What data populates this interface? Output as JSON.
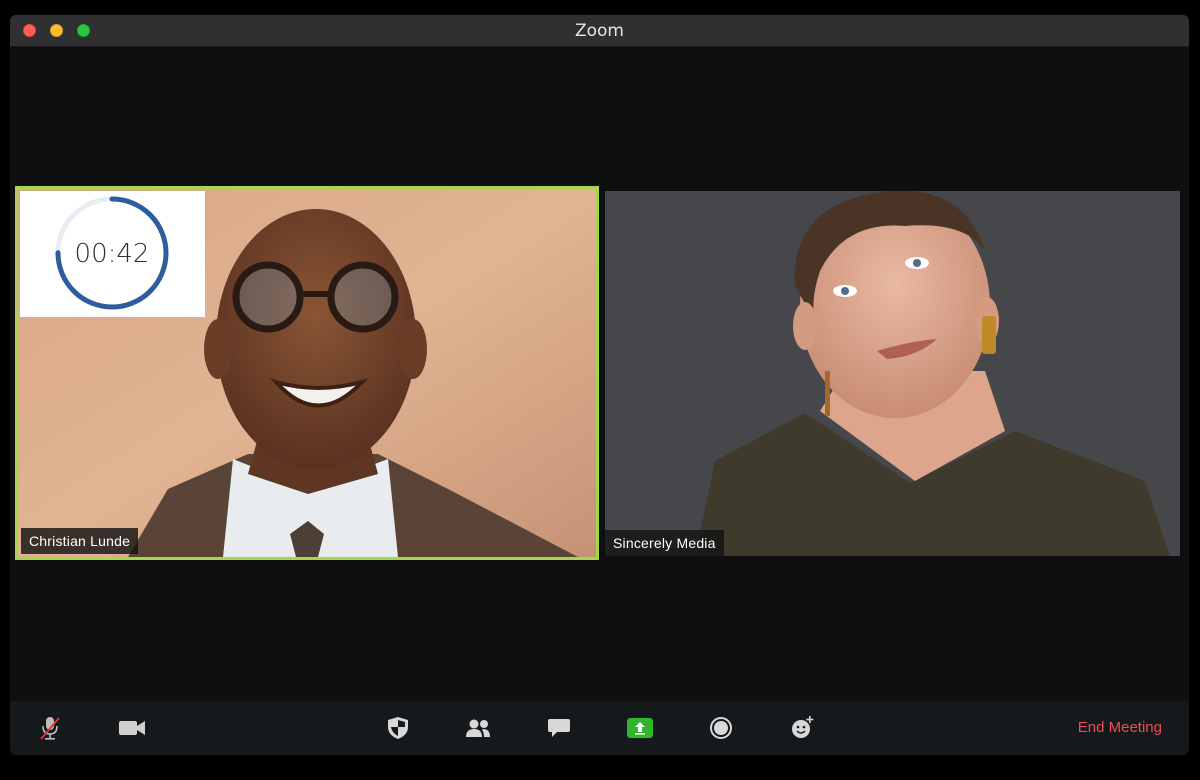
{
  "window": {
    "title": "Zoom"
  },
  "participants": [
    {
      "name": "Christian Lunde",
      "active_speaker": true,
      "highlight_color": "#a6d64a"
    },
    {
      "name": "Sincerely Media",
      "active_speaker": false
    }
  ],
  "timer": {
    "text": "00:42",
    "progress": 0.75,
    "ring_color": "#2d5d9f",
    "track_color": "#e8edf4"
  },
  "toolbar": {
    "icons": [
      "mic-muted-icon",
      "video-camera-icon",
      "security-shield-icon",
      "participants-icon",
      "chat-icon",
      "share-screen-icon",
      "record-icon",
      "reactions-icon"
    ],
    "share_color": "#2fb62c",
    "end_label": "End Meeting",
    "end_color": "#ef4a57"
  }
}
